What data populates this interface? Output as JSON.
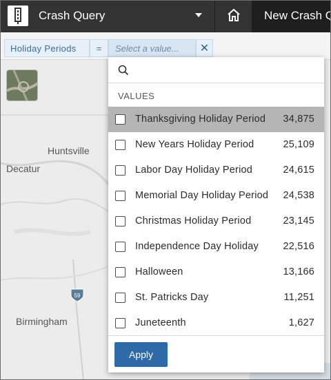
{
  "header": {
    "app_title": "Crash Query",
    "tab_label": "New Crash Q"
  },
  "filter": {
    "field": "Holiday Periods",
    "operator": "=",
    "value_placeholder": "Select a value...",
    "clear_symbol": "✕"
  },
  "map": {
    "cities": [
      "Huntsville",
      "Decatur",
      "Birmingham"
    ],
    "highway_shield": "59"
  },
  "dropdown": {
    "search_placeholder": "",
    "values_header": "VALUES",
    "apply_label": "Apply",
    "items": [
      {
        "label": "Thanksgiving Holiday Period",
        "count": "34,875",
        "highlighted": true
      },
      {
        "label": "New Years Holiday Period",
        "count": "25,109"
      },
      {
        "label": "Labor Day Holiday Period",
        "count": "24,615"
      },
      {
        "label": "Memorial Day Holiday Period",
        "count": "24,538"
      },
      {
        "label": "Christmas Holiday Period",
        "count": "23,145"
      },
      {
        "label": "Independence Day Holiday",
        "count": "22,516"
      },
      {
        "label": "Halloween",
        "count": "13,166"
      },
      {
        "label": "St. Patricks Day",
        "count": "11,251"
      },
      {
        "label": "Juneteenth",
        "count": "1,627"
      }
    ]
  },
  "colors": {
    "header_bg": "#333333",
    "accent": "#2f6aa8",
    "highlight_row": "#b5b5b5"
  }
}
